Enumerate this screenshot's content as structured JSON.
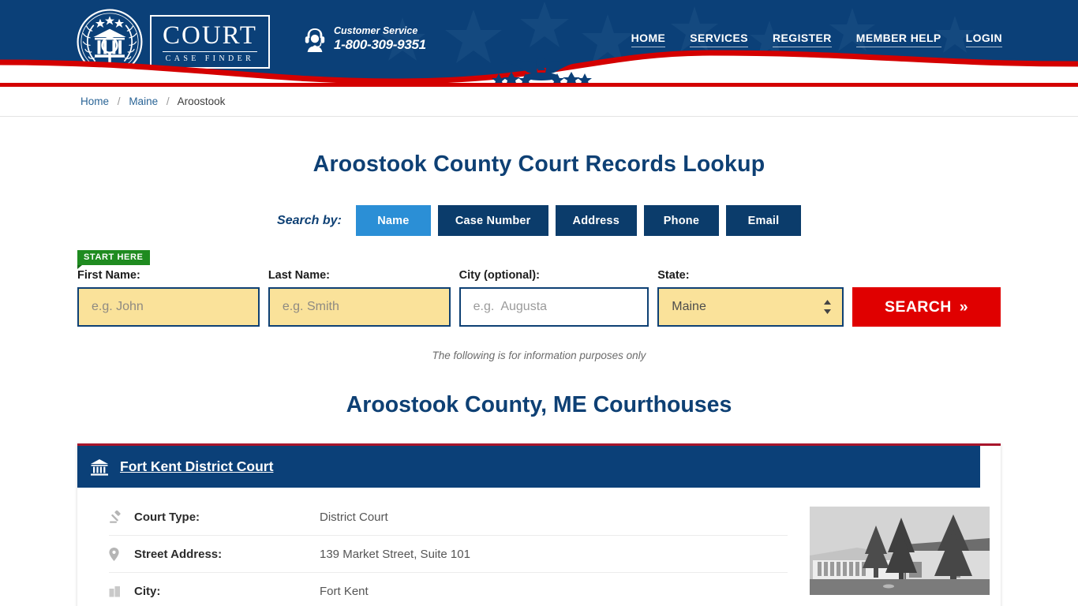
{
  "header": {
    "logo": {
      "word": "COURT",
      "sub": "CASE FINDER",
      "icon": "court-seal-icon"
    },
    "customer_service": {
      "label": "Customer Service",
      "phone": "1-800-309-9351",
      "icon": "headset-support-icon"
    },
    "nav": [
      {
        "label": "HOME"
      },
      {
        "label": "SERVICES"
      },
      {
        "label": "REGISTER"
      },
      {
        "label": "MEMBER HELP"
      },
      {
        "label": "LOGIN"
      }
    ],
    "colors": {
      "banner_blue": "#0b4078",
      "red_rule": "#d40000",
      "accent_blue": "#2b8fd6"
    }
  },
  "breadcrumb": {
    "items": [
      {
        "label": "Home",
        "link": true
      },
      {
        "label": "Maine",
        "link": true
      },
      {
        "label": "Aroostook",
        "link": false
      }
    ],
    "separator": "/"
  },
  "main": {
    "page_title": "Aroostook County Court Records Lookup",
    "search_by_label": "Search by:",
    "tabs": [
      {
        "label": "Name",
        "active": true
      },
      {
        "label": "Case Number",
        "active": false
      },
      {
        "label": "Address",
        "active": false
      },
      {
        "label": "Phone",
        "active": false
      },
      {
        "label": "Email",
        "active": false
      }
    ],
    "start_badge": "START HERE",
    "form": {
      "first_name": {
        "label": "First Name:",
        "placeholder": "e.g. John",
        "value": ""
      },
      "last_name": {
        "label": "Last Name:",
        "placeholder": "e.g. Smith",
        "value": ""
      },
      "city": {
        "label": "City (optional):",
        "placeholder": "e.g.  Augusta",
        "value": ""
      },
      "state": {
        "label": "State:",
        "value": "Maine"
      },
      "search_button": "SEARCH",
      "search_button_chevron": "»"
    },
    "disclaimer": "The following is for information purposes only",
    "section_title": "Aroostook County, ME Courthouses"
  },
  "court_card": {
    "name": "Fort Kent District Court",
    "icon": "courthouse-icon",
    "photo_alt": "courthouse-photo",
    "details": [
      {
        "icon": "gavel-icon",
        "key": "Court Type:",
        "value": "District Court"
      },
      {
        "icon": "map-pin-icon",
        "key": "Street Address:",
        "value": "139 Market Street, Suite 101"
      },
      {
        "icon": "city-icon",
        "key": "City:",
        "value": "Fort Kent"
      }
    ]
  }
}
